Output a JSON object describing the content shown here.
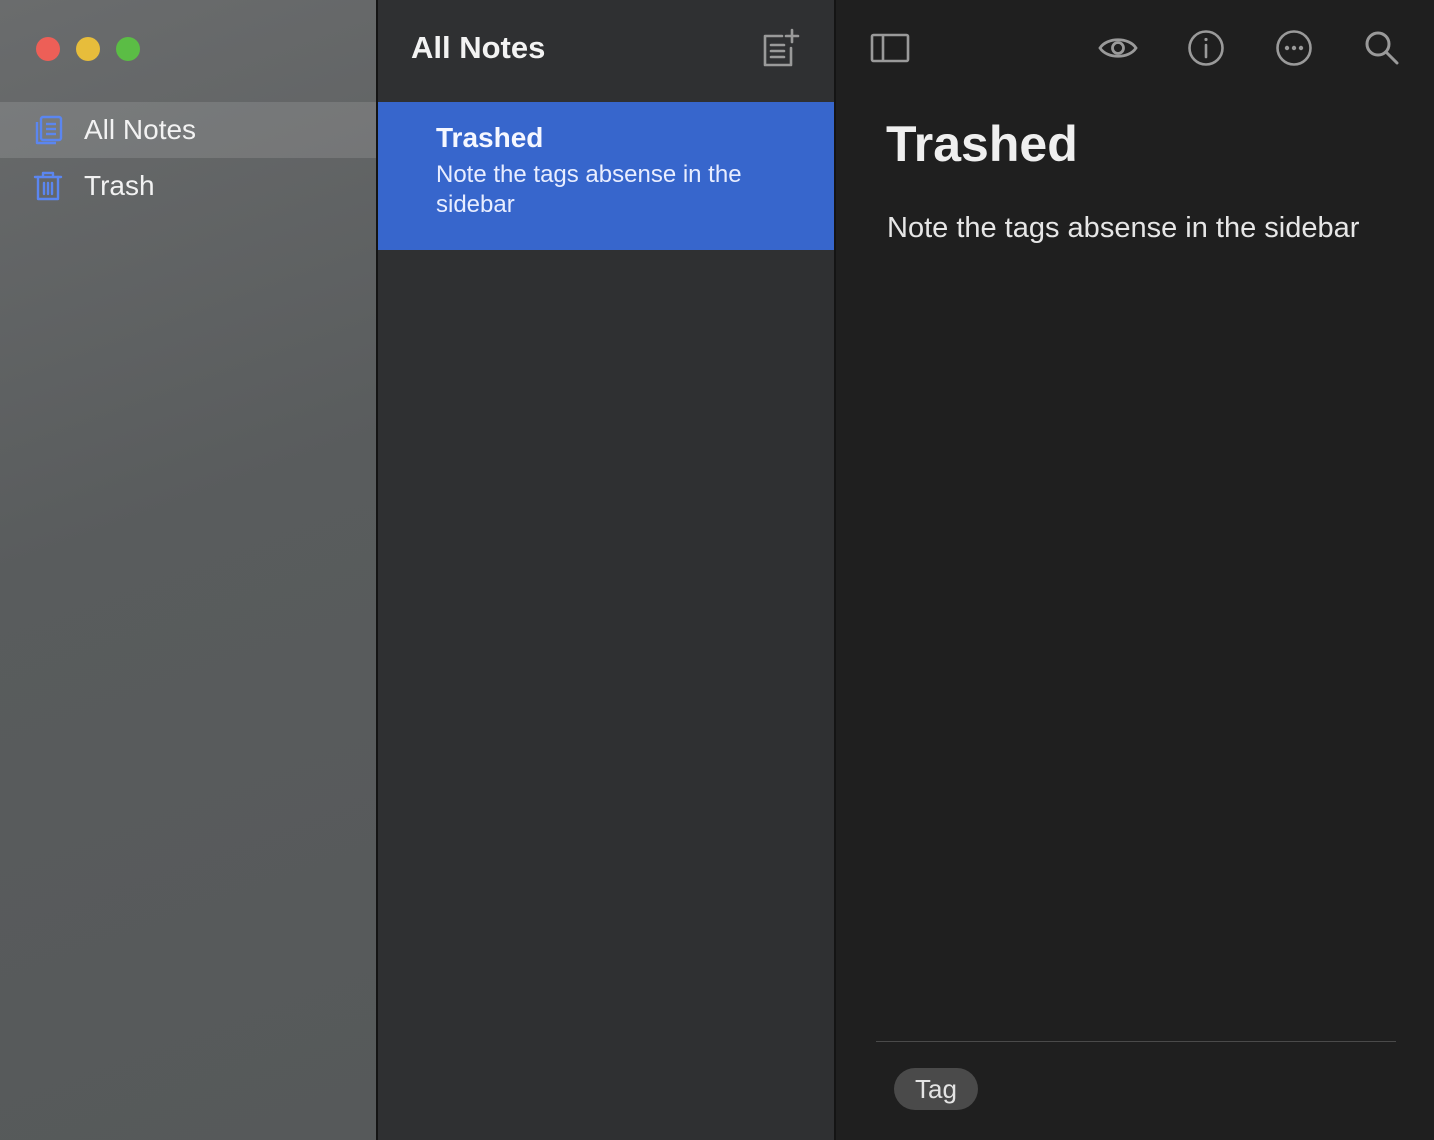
{
  "window": {
    "traffic_lights": [
      "close",
      "minimize",
      "zoom"
    ]
  },
  "sidebar": {
    "items": [
      {
        "label": "All Notes",
        "icon": "notes-stack-icon",
        "active": true
      },
      {
        "label": "Trash",
        "icon": "trash-icon",
        "active": false
      }
    ],
    "accent_color": "#5b86f0"
  },
  "note_list": {
    "title": "All Notes",
    "new_note_icon": "new-note-icon",
    "selected_color": "#3766cc",
    "notes": [
      {
        "title": "Trashed",
        "snippet": "Note the tags absense in the sidebar",
        "selected": true
      }
    ]
  },
  "toolbar": {
    "icons": [
      "sidebar-toggle-icon",
      "preview-eye-icon",
      "info-icon",
      "more-options-icon",
      "search-icon"
    ]
  },
  "editor": {
    "title": "Trashed",
    "body": "Note the tags absense in the sidebar",
    "tag_placeholder": "Tag"
  }
}
